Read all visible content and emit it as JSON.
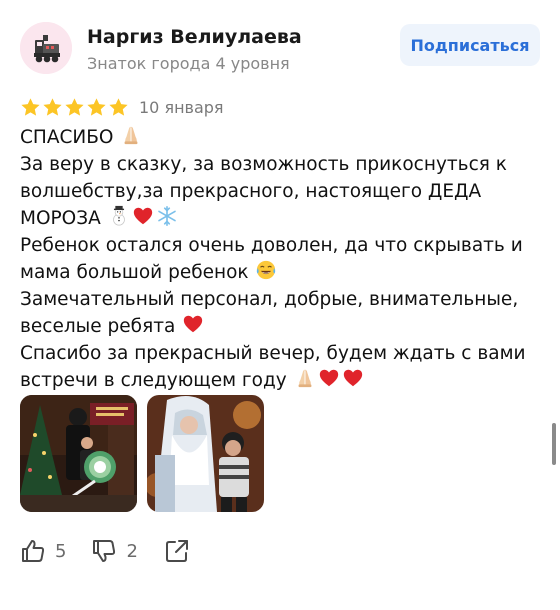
{
  "author": {
    "name": "Наргиз Велиулаева",
    "level": "Знаток города 4 уровня",
    "avatar_icon": "train-icon"
  },
  "subscribe_label": "Подписаться",
  "review": {
    "rating": 5,
    "max_rating": 5,
    "date": "10 января",
    "lines": [
      {
        "text": "СПАСИБО",
        "emoji_after": [
          "praying-hands"
        ]
      },
      {
        "text": "За веру в сказку, за возможность прикоснуться к",
        "emoji_after": []
      },
      {
        "text": "волшебству,за прекрасного, настоящего ДЕДА",
        "emoji_after": []
      },
      {
        "text": "МОРОЗА",
        "emoji_after": [
          "snowman",
          "red-heart",
          "snowflake"
        ]
      },
      {
        "text": "Ребенок остался очень доволен, да что скрывать и",
        "emoji_after": []
      },
      {
        "text": "мама большой ребенок",
        "emoji_after": [
          "tears-of-joy"
        ]
      },
      {
        "text": "Замечательный персонал, добрые, внимательные,",
        "emoji_after": []
      },
      {
        "text": "веселые ребята",
        "emoji_after": [
          "red-heart"
        ]
      },
      {
        "text": "Спасибо за прекрасный вечер, будем ждать с вами",
        "emoji_after": []
      },
      {
        "text": "встречи в следующем году",
        "emoji_after": [
          "praying-hands",
          "red-heart",
          "red-heart"
        ]
      }
    ]
  },
  "photos": [
    {
      "name": "photo-family-christmas-tree"
    },
    {
      "name": "photo-child-with-santa"
    }
  ],
  "actions": {
    "likes": "5",
    "dislikes": "2"
  },
  "colors": {
    "star": "#fcc525",
    "accent": "#2b6fd8",
    "button_bg": "#eef4fc",
    "heart": "#e0242b"
  }
}
